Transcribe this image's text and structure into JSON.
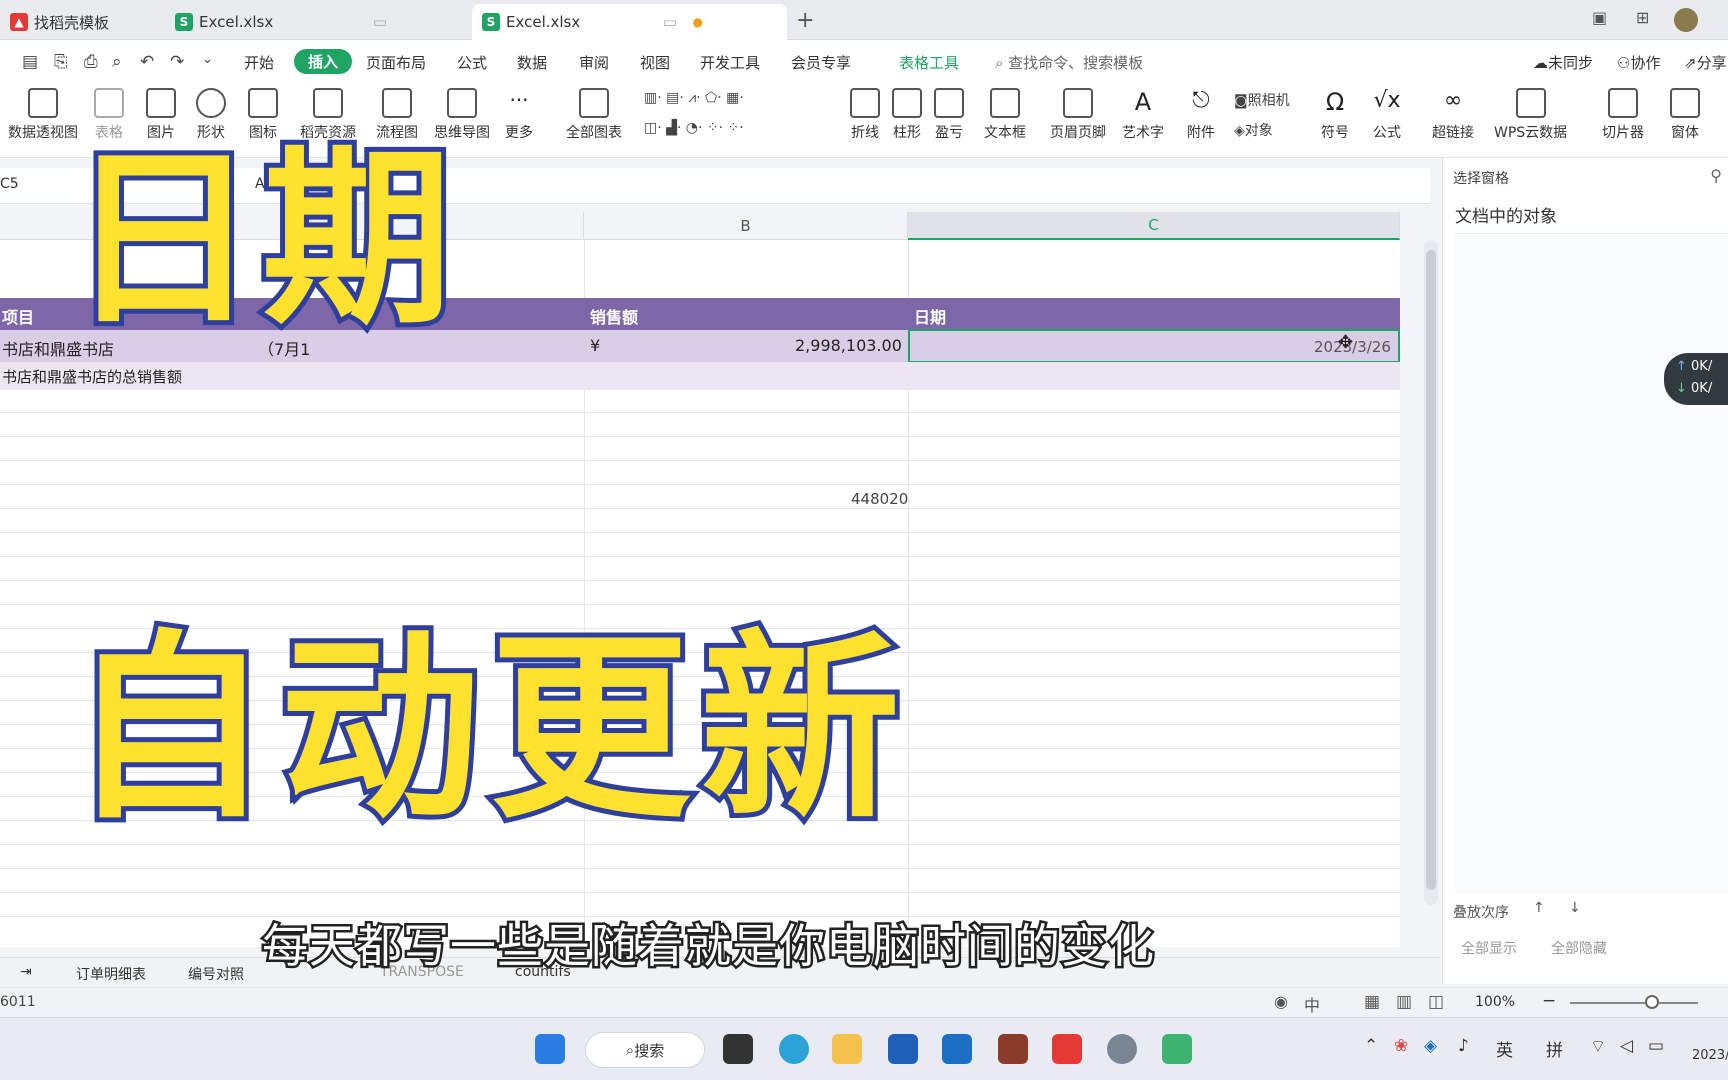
{
  "tabs": [
    {
      "label": "找稻壳模板",
      "icon_color": "#e53935"
    },
    {
      "label": "Excel.xlsx",
      "icon_color": "#1fa463"
    },
    {
      "label": "Excel.xlsx",
      "icon_color": "#1fa463"
    }
  ],
  "titlebar": {
    "new_tab": "+"
  },
  "menu": {
    "items": [
      "开始",
      "插入",
      "页面布局",
      "公式",
      "数据",
      "审阅",
      "视图",
      "开发工具",
      "会员专享",
      "表格工具"
    ],
    "search": "查找命令、搜索模板",
    "right": [
      "未同步",
      "协作",
      "分享"
    ]
  },
  "ribbon": {
    "buttons": [
      "数据透视图",
      "表格",
      "图片",
      "形状",
      "图标",
      "稻壳资源",
      "流程图",
      "思维导图",
      "更多",
      "全部图表",
      "折线",
      "柱形",
      "盈亏",
      "文本框",
      "页眉页脚",
      "艺术字",
      "附件",
      "符号",
      "公式",
      "超链接",
      "WPS云数据",
      "切片器",
      "窗体"
    ],
    "small": [
      "照相机",
      "对象"
    ]
  },
  "formula": {
    "name_box": "C5",
    "content": "AY()"
  },
  "sheet": {
    "columns": [
      "B",
      "C"
    ],
    "header_row": {
      "a": "项目",
      "b": "销售额",
      "c": "日期"
    },
    "row1": {
      "a": "书店和鼎盛书店",
      "a2": "（7月1",
      "currency": "¥",
      "b": "2,998,103.00",
      "c": "2023/3/26"
    },
    "row2": {
      "a": "书店和鼎盛书店的总销售额"
    },
    "loose_value": "448020"
  },
  "right_pane": {
    "title": "选择窗格",
    "subtitle": "文档中的对象",
    "order": "叠放次序",
    "show_all": "全部显示",
    "hide_all": "全部隐藏",
    "net_up": "0K/",
    "net_down": "0K/"
  },
  "sheet_tabs": [
    "订单明细表",
    "编号对照",
    "TRANSPOSE",
    "countifs"
  ],
  "status": {
    "left": "6011",
    "zoom": "100%"
  },
  "taskbar": {
    "search": "搜索",
    "tray": [
      "英",
      "拼"
    ],
    "clock": "2023/"
  },
  "overlay": {
    "line1": "日期",
    "line2": "自动更新",
    "subtitle": "每天都写一些是随着就是你电脑时间的变化"
  },
  "colors": {
    "accent": "#1fa463",
    "table_header": "#7e67a8",
    "table_row": "#d8cfe6",
    "overlay_fill": "#ffe22e",
    "overlay_stroke": "#2f3f9e"
  }
}
